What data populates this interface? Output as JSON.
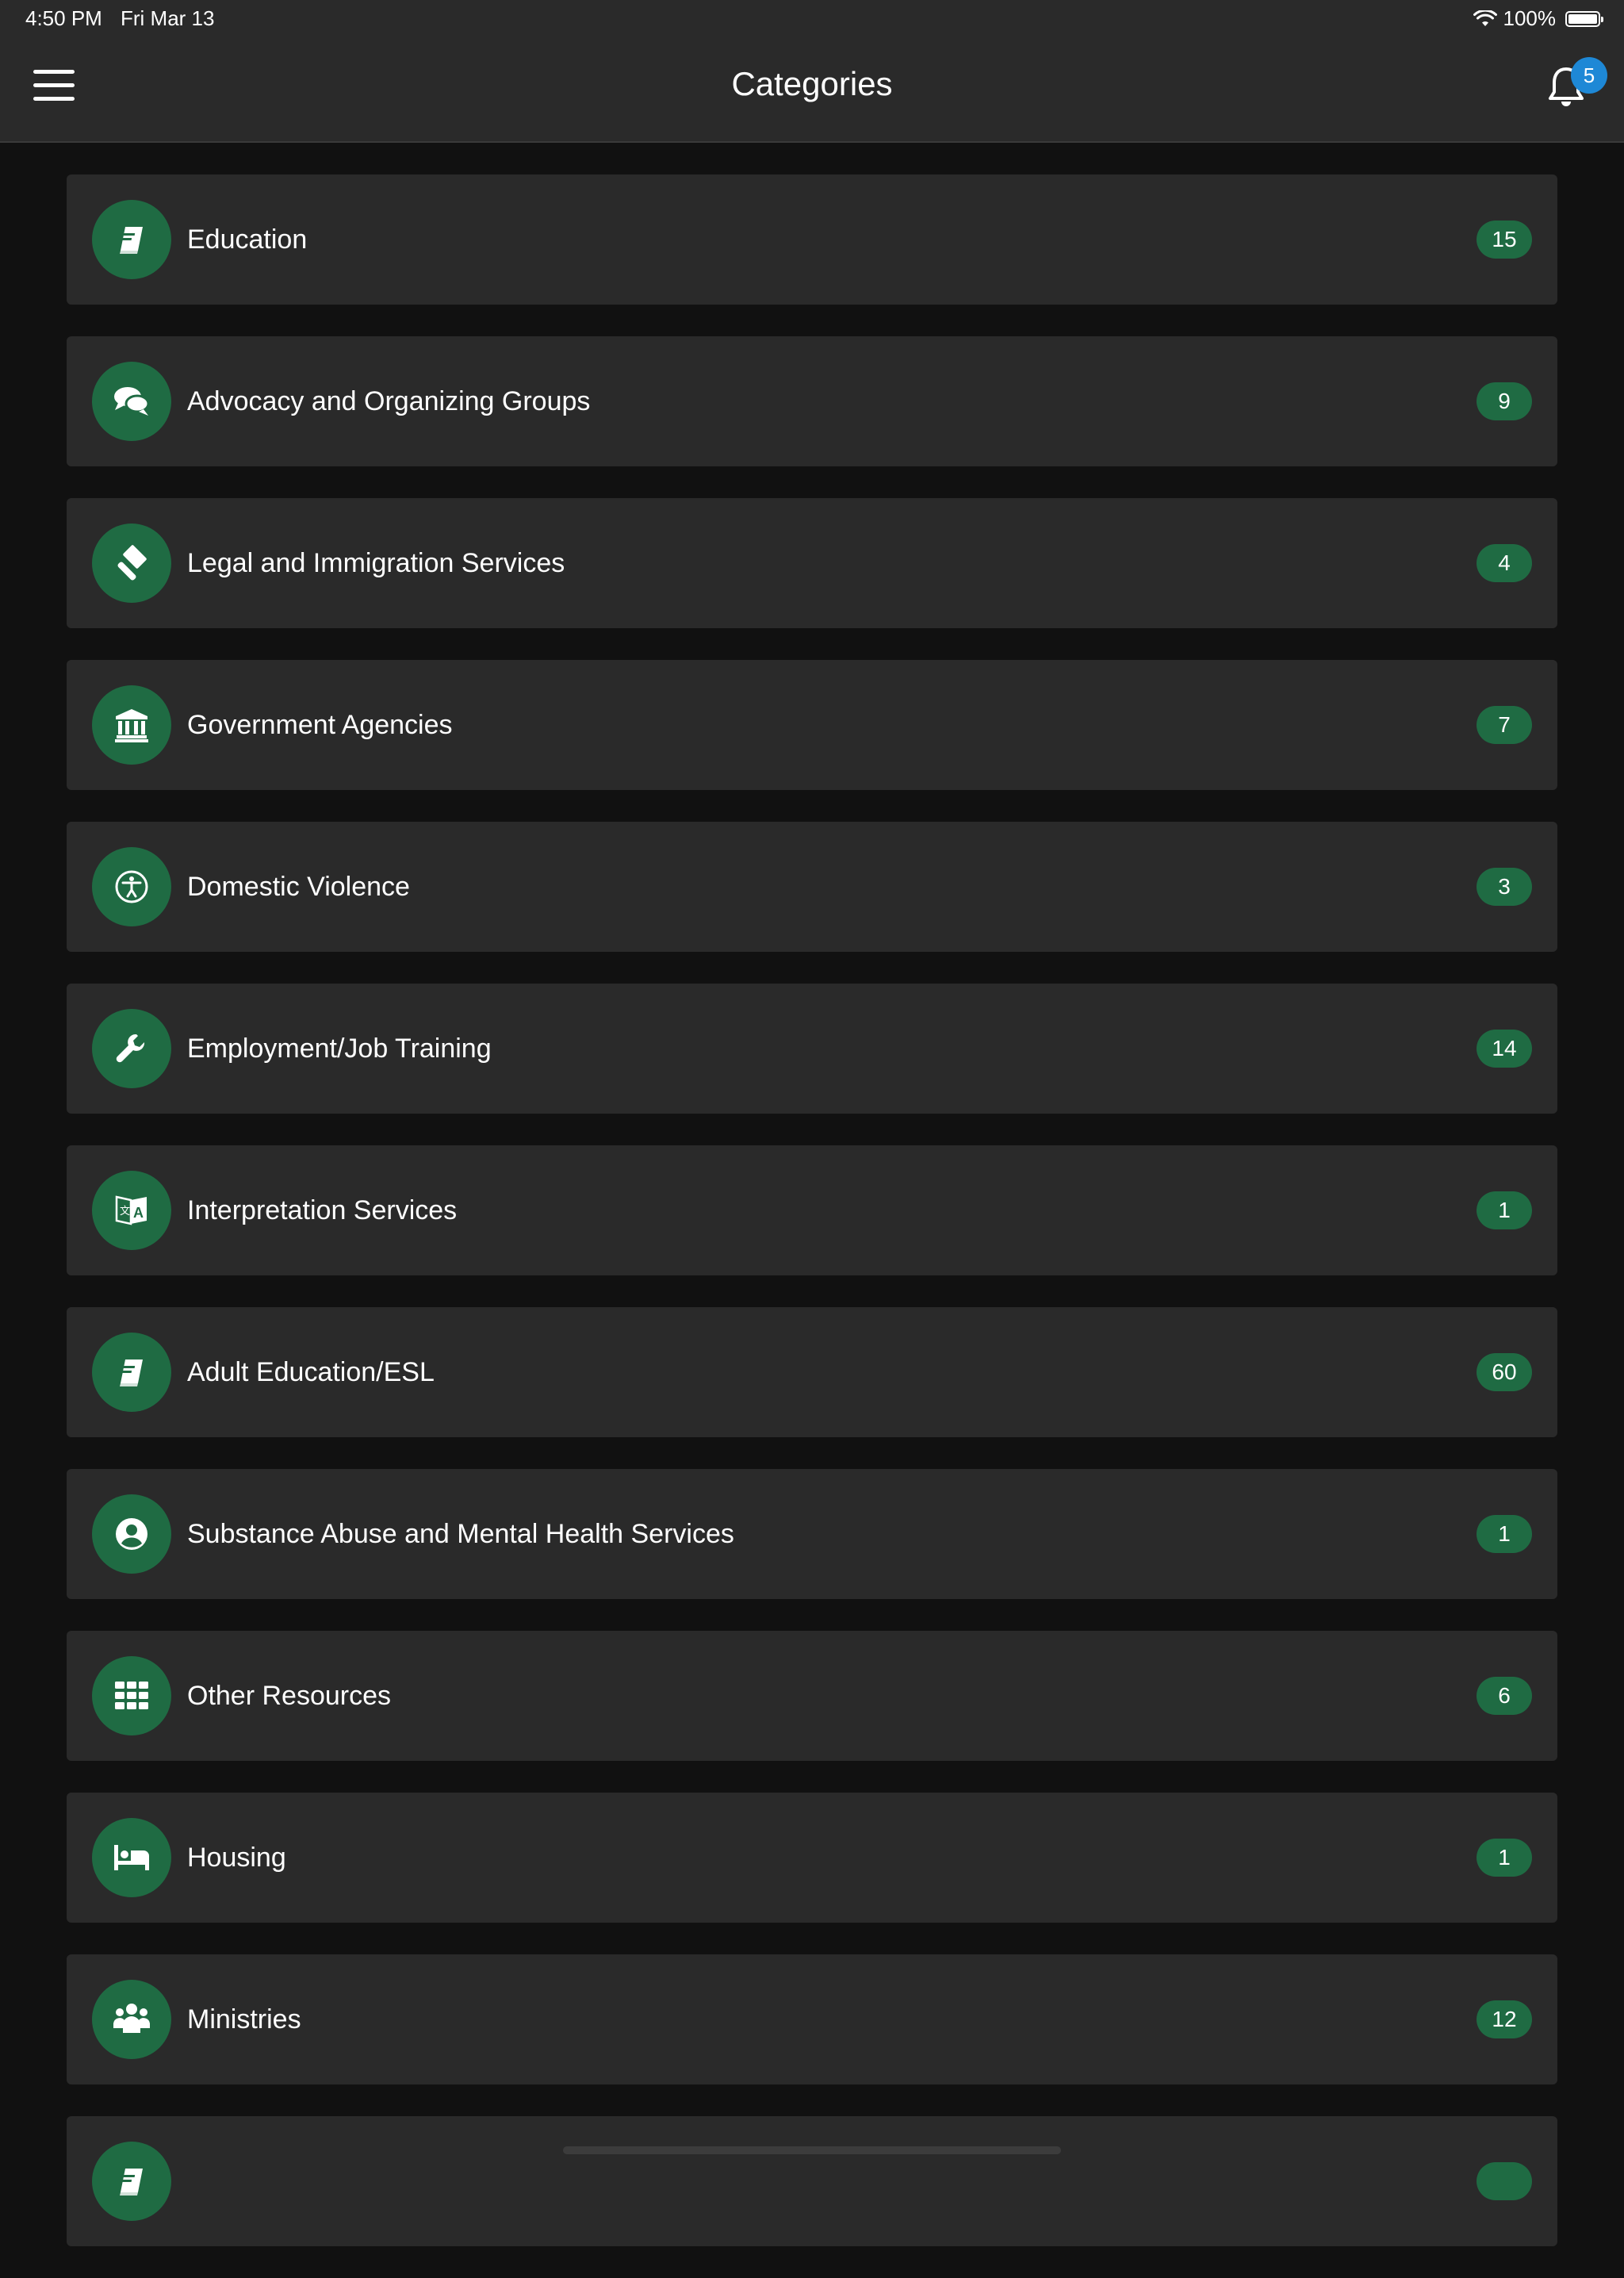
{
  "status_bar": {
    "time": "4:50 PM",
    "date": "Fri Mar 13",
    "battery": "100%",
    "battery_level": 1.0
  },
  "header": {
    "title": "Categories",
    "menu_icon": "hamburger-menu-icon",
    "bell_icon": "bell-icon",
    "notification_count": "5"
  },
  "colors": {
    "accent": "#1f6b43",
    "badge_blue": "#1e88d6",
    "card_bg": "#2a2a2a",
    "page_bg": "#111111"
  },
  "categories": [
    {
      "label": "Education",
      "count": "15",
      "icon": "book-icon"
    },
    {
      "label": "Advocacy and Organizing Groups",
      "count": "9",
      "icon": "chat-bubbles-icon"
    },
    {
      "label": "Legal and Immigration Services",
      "count": "4",
      "icon": "gavel-icon"
    },
    {
      "label": "Government Agencies",
      "count": "7",
      "icon": "government-building-icon"
    },
    {
      "label": "Domestic Violence",
      "count": "3",
      "icon": "universal-access-icon"
    },
    {
      "label": "Employment/Job Training",
      "count": "14",
      "icon": "wrench-icon"
    },
    {
      "label": "Interpretation Services",
      "count": "1",
      "icon": "language-icon"
    },
    {
      "label": "Adult Education/ESL",
      "count": "60",
      "icon": "book-icon"
    },
    {
      "label": "Substance Abuse and Mental Health Services",
      "count": "1",
      "icon": "user-circle-icon"
    },
    {
      "label": "Other Resources",
      "count": "6",
      "icon": "grid-icon"
    },
    {
      "label": "Housing",
      "count": "1",
      "icon": "bed-icon"
    },
    {
      "label": "Ministries",
      "count": "12",
      "icon": "people-group-icon"
    },
    {
      "label": "",
      "count": "",
      "icon": "book-icon"
    }
  ]
}
